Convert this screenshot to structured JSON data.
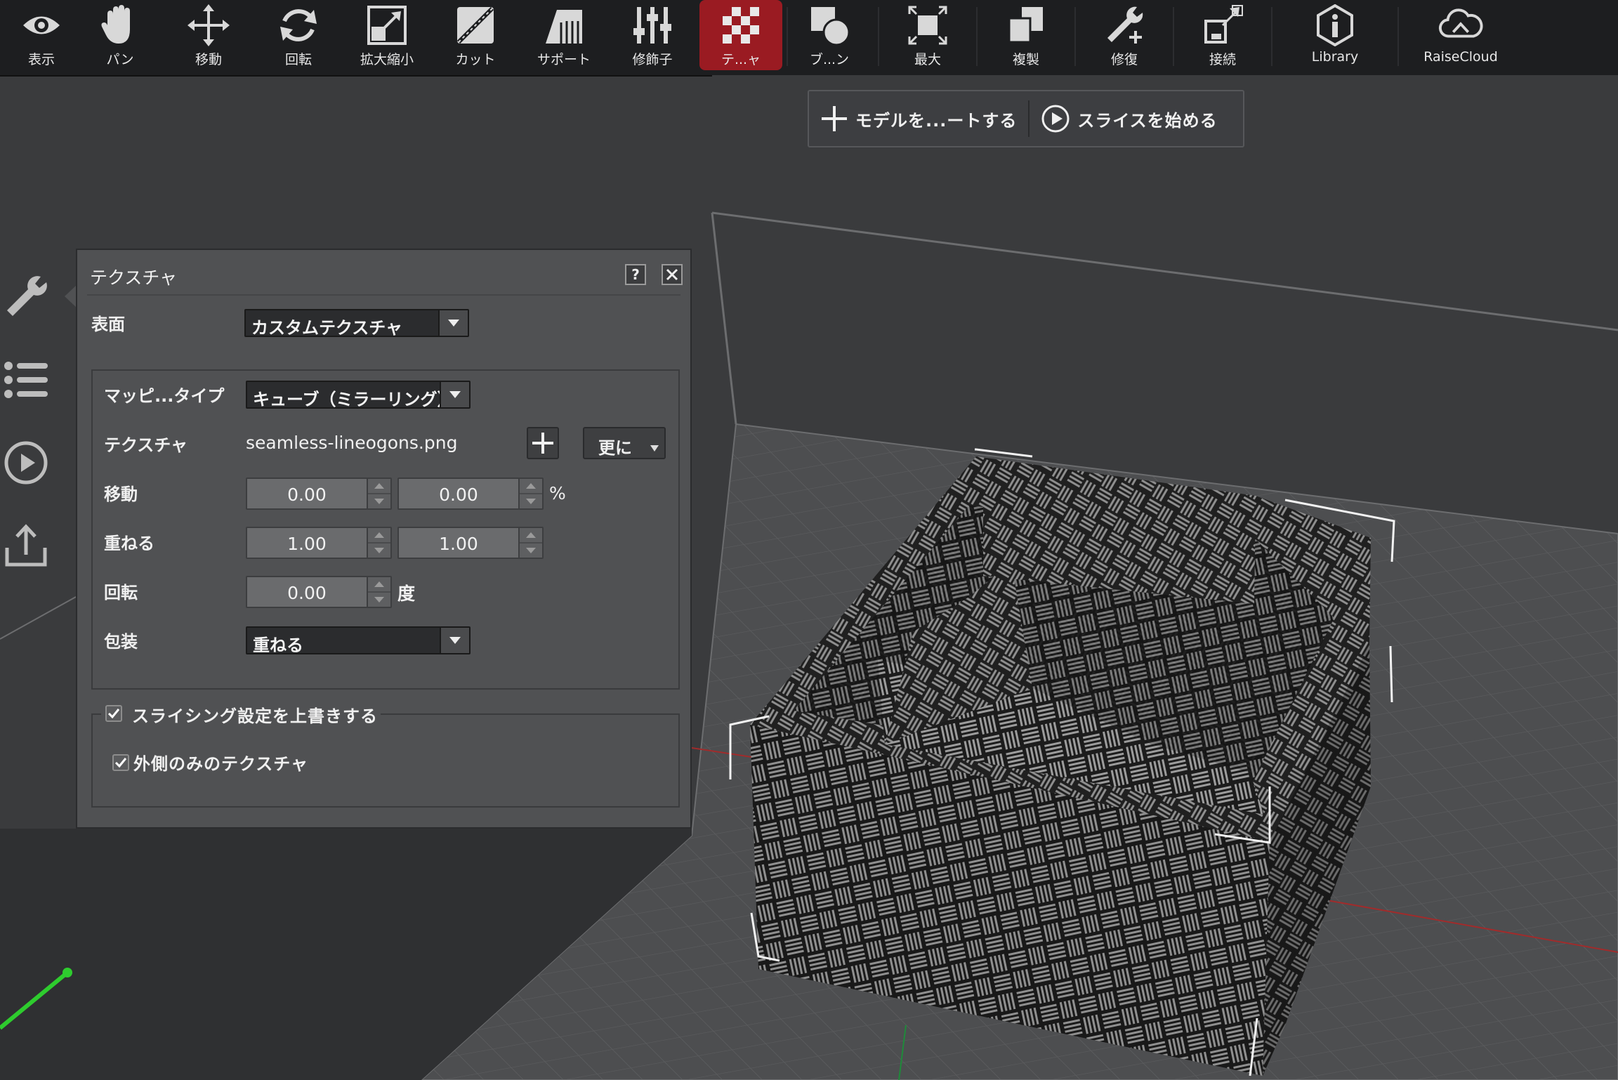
{
  "toolbar": {
    "tools": [
      {
        "label": "表示",
        "icon": "eye-icon"
      },
      {
        "label": "パン",
        "icon": "hand-icon"
      },
      {
        "label": "移動",
        "icon": "move-icon"
      },
      {
        "label": "回転",
        "icon": "rotate-icon"
      },
      {
        "label": "拡大縮小",
        "icon": "scale-icon"
      },
      {
        "label": "カット",
        "icon": "cut-icon"
      },
      {
        "label": "サポート",
        "icon": "support-icon"
      },
      {
        "label": "修飾子",
        "icon": "modifier-icon"
      },
      {
        "label": "テ...ャ",
        "icon": "texture-icon",
        "active": true
      },
      {
        "label": "ブ...ン",
        "icon": "boolean-icon"
      },
      {
        "label": "最大",
        "icon": "maximize-icon"
      },
      {
        "label": "複製",
        "icon": "duplicate-icon"
      },
      {
        "label": "修復",
        "icon": "repair-icon"
      },
      {
        "label": "接続",
        "icon": "connect-icon"
      },
      {
        "label": "Library",
        "icon": "library-icon"
      },
      {
        "label": "RaiseCloud",
        "icon": "cloud-icon"
      }
    ]
  },
  "actionbar": {
    "import_label": "モデルを...ートする",
    "slice_label": "スライスを始める"
  },
  "panel": {
    "title": "テクスチャ",
    "help_label": "?",
    "surface_label": "表面",
    "surface_value": "カスタムテクスチャ",
    "mapping_label": "マッピ...タイプ",
    "mapping_value": "キューブ（ミラーリング）",
    "texture_label": "テクスチャ",
    "texture_file": "seamless-lineogons.png",
    "more_label": "更に",
    "move_label": "移動",
    "move_x": "0.00",
    "move_y": "0.00",
    "move_unit": "%",
    "scale_label": "重ねる",
    "scale_x": "1.00",
    "scale_y": "1.00",
    "rotate_label": "回転",
    "rotate_value": "0.00",
    "rotate_unit": "度",
    "wrap_label": "包装",
    "wrap_value": "重ねる",
    "override_label": "スライシング設定を上書きする",
    "override_checked": true,
    "outside_only_label": "外側のみのテクスチャ",
    "outside_only_checked": true
  },
  "colors": {
    "accent_active": "#9a1b22",
    "toolbar_bg": "#1d1e20",
    "panel_bg": "#505153",
    "viewport_bg": "#3a3b3d"
  }
}
